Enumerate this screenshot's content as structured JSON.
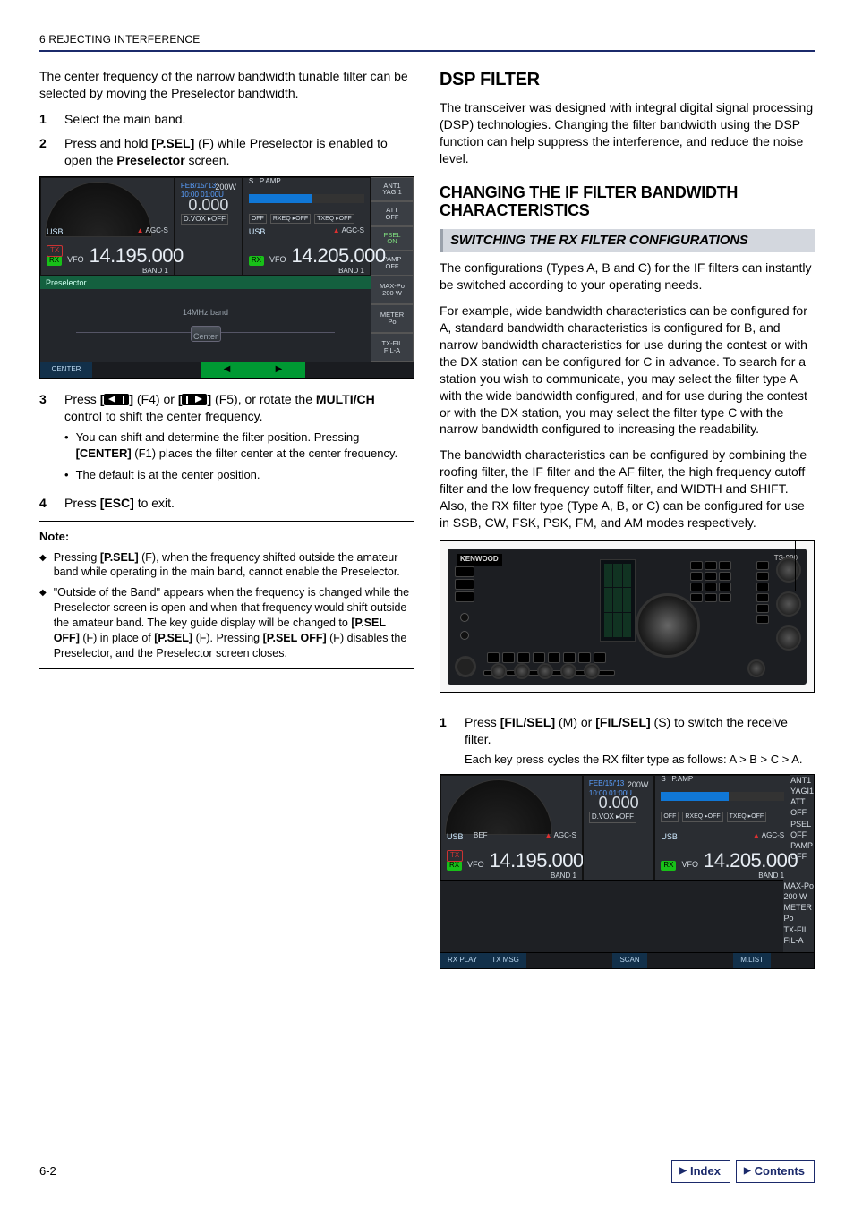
{
  "running_head": "6 REJECTING INTERFERENCE",
  "page_number": "6-2",
  "footer_buttons": {
    "index": "Index",
    "contents": "Contents"
  },
  "left": {
    "intro": "The center frequency of the narrow bandwidth tunable filter can be selected by moving the Preselector bandwidth.",
    "steps": {
      "s1": "Select the main band.",
      "s2_a": "Press and hold ",
      "s2_b": "[P.SEL]",
      "s2_c": " (F) while Preselector is enabled to open the ",
      "s2_d": "Preselector",
      "s2_e": " screen.",
      "s3_a": "Press ",
      "s3_b": "[",
      "s3_c": "]",
      "s3_d": " (F4) or ",
      "s3_e": "[",
      "s3_f": "]",
      "s3_g": " (F5), or rotate the ",
      "s3_h": "MULTI/CH",
      "s3_i": " control to shift the center frequency.",
      "s3_bullets": {
        "b1_a": "You can shift and determine the filter position. Pressing ",
        "b1_b": "[CENTER]",
        "b1_c": " (F1) places the filter center at the center frequency.",
        "b2": "The default is at the center position."
      },
      "s4_a": "Press ",
      "s4_b": "[ESC]",
      "s4_c": " to exit."
    },
    "note_head": "Note:",
    "notes": {
      "n1_a": "Pressing ",
      "n1_b": "[P.SEL]",
      "n1_c": " (F), when the frequency shifted outside the amateur band while operating in the main band, cannot enable the Preselector.",
      "n2_a": "\"Outside of the Band\" appears when the frequency is changed while the Preselector screen is open and when that frequency would shift outside the amateur band. The key guide display will be changed to ",
      "n2_b": "[P.SEL OFF]",
      "n2_c": " (F) in place of ",
      "n2_d": "[P.SEL]",
      "n2_e": " (F). Pressing ",
      "n2_f": "[P.SEL OFF]",
      "n2_g": " (F) disables the Preselector, and the Preselector screen closes."
    },
    "screenshot1": {
      "date": "FEB/15/'13",
      "time": "10:00 01:00U",
      "split": "0.000",
      "dvox": "D.VOX ▸OFF",
      "power": "200W",
      "pamp": "P.AMP",
      "off_l": "OFF",
      "rxeq": "RXEQ ▸OFF",
      "txeq": "TXEQ ▸OFF",
      "usb": "USB",
      "agc": "AGC-S",
      "rx": "RX",
      "tx": "TX",
      "vfo": "VFO",
      "freq_main": "14.195.000",
      "freq_sub": "14.205.000",
      "band": "BAND 1",
      "s": "S",
      "side": {
        "ant": "ANT1\nYAGI1",
        "att": "ATT\nOFF",
        "psel": "PSEL\nON",
        "pampbtn": "PAMP\nOFF",
        "maxpo": "MAX-Po\n200 W",
        "meter": "METER\nPo",
        "txfil": "TX-FIL\nFIL-A"
      },
      "preselector_title": "Preselector",
      "preselector_band": "14MHz band",
      "preselector_center": "Center",
      "bottom": {
        "center": "CENTER",
        "left_arrow": "◀",
        "right_arrow": "▶"
      }
    }
  },
  "right": {
    "h_dsp": "DSP FILTER",
    "p_dsp": "The transceiver was designed with integral digital signal processing (DSP) technologies. Changing the filter bandwidth using the DSP function can help suppress the interference, and reduce the noise level.",
    "h_if": "CHANGING THE IF FILTER BANDWIDTH CHARACTERISTICS",
    "bar_switch": "SWITCHING THE RX FILTER CONFIGURATIONS",
    "p_conf": "The configurations (Types A, B and C) for the IF filters can instantly be switched according to your operating needs.",
    "p_example": "For example, wide bandwidth characteristics can be configured for A, standard bandwidth characteristics is configured for B, and narrow bandwidth characteristics for use during the contest or with the DX station can be configured for C in advance. To search for a station you wish to communicate, you may select the filter type A with the wide bandwidth configured, and for use during the contest or with the DX station, you may select the filter type C with the narrow bandwidth configured to increasing the readability.",
    "p_bw": "The bandwidth characteristics can be configured by combining the roofing filter, the IF filter and the AF filter, the high frequency cutoff filter and the low frequency cutoff filter, and WIDTH and SHIFT. Also, the RX filter type (Type A, B, or C) can be configured for use in SSB, CW, FSK, PSK, FM, and AM modes respectively.",
    "radio": {
      "brand": "KENWOOD",
      "model": "TS-990"
    },
    "steps": {
      "s1_a": "Press ",
      "s1_b": "[FIL/SEL]",
      "s1_c": " (M) or ",
      "s1_d": "[FIL/SEL]",
      "s1_e": " (S) to switch the receive filter.",
      "s1_note": "Each key press cycles the RX filter type as follows: A > B > C > A."
    },
    "screenshot2": {
      "date": "FEB/15/'13",
      "time": "10:00 01:00U",
      "split": "0.000",
      "dvox": "D.VOX ▸OFF",
      "power": "200W",
      "pamp": "P.AMP",
      "off_l": "OFF",
      "rxeq": "RXEQ ▸OFF",
      "txeq": "TXEQ ▸OFF",
      "usb": "USB",
      "bef": "BEF",
      "agc": "AGC-S",
      "rx": "RX",
      "tx": "TX",
      "vfo": "VFO",
      "freq_main": "14.195.000",
      "freq_sub": "14.205.000",
      "band": "BAND 1",
      "s": "S",
      "side": {
        "ant": "ANT1\nYAGI1",
        "att": "ATT\nOFF",
        "psel": "PSEL\nOFF",
        "pampbtn": "PAMP\nOFF",
        "maxpo": "MAX-Po\n200 W",
        "meter": "METER\nPo",
        "txfil": "TX-FIL\nFIL-A"
      },
      "bottom": {
        "rxplay": "RX PLAY",
        "txmsg": "TX MSG",
        "scan": "SCAN",
        "mlist": "M.LIST"
      }
    }
  }
}
